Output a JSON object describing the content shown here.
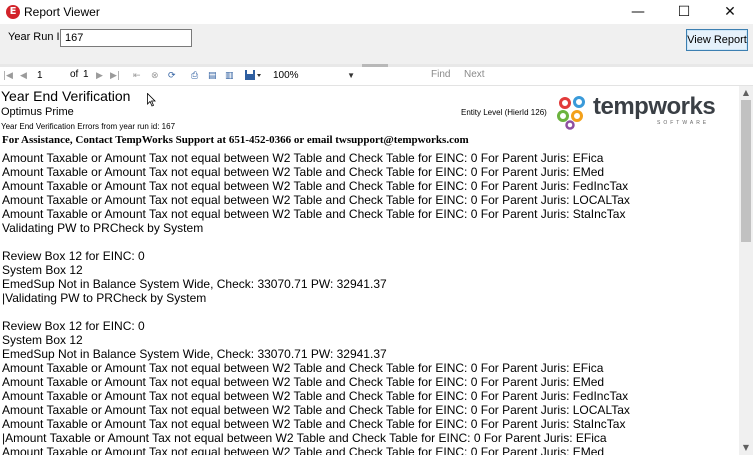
{
  "window": {
    "app_icon": "E",
    "title": "Report Viewer",
    "minimize_glyph": "—",
    "maximize_glyph": "☐",
    "close_glyph": "✕"
  },
  "params": {
    "year_run_label": "Year Run ID",
    "year_run_value": "167",
    "view_report_label": "View Report"
  },
  "toolbar": {
    "first_glyph": "|◀",
    "prev_glyph": "◀",
    "page": "1",
    "of_label": "of",
    "total_pages": "1",
    "next_glyph": "▶",
    "last_glyph": "▶|",
    "back_glyph": "⇤",
    "stop_glyph": "⊗",
    "refresh_glyph": "⟳",
    "print_glyph": "⎙",
    "layout_glyph": "▤",
    "setup_glyph": "▥",
    "export_glyph": "▼",
    "zoom": "100%",
    "find_label": "Find",
    "next_label": "Next"
  },
  "report": {
    "title": "Year End Verification",
    "company": "Optimus Prime",
    "errors_heading": "Year End Verification Errors from year run id: 167",
    "entity_level": "Entity Level (HierId 126)",
    "logo_text": "tempworks",
    "logo_sub": "SOFTWARE",
    "assistance": "For Assistance, Contact TempWorks Support at 651-452-0366 or email twsupport@tempworks.com",
    "lines": [
      "Amount Taxable or Amount Tax not equal between W2 Table and Check Table for EINC: 0 For Parent Juris: EFica",
      "Amount Taxable or Amount Tax not equal between W2 Table and Check Table for EINC: 0 For Parent Juris: EMed",
      "Amount Taxable or Amount Tax not equal between W2 Table and Check Table for EINC: 0 For Parent Juris: FedIncTax",
      "Amount Taxable or Amount Tax not equal between W2 Table and Check Table for EINC: 0 For Parent Juris: LOCALTax",
      "Amount Taxable or Amount Tax not equal between W2 Table and Check Table for EINC: 0 For Parent Juris: StaIncTax",
      "Validating PW to PRCheck by System",
      "",
      "Review Box 12 for EINC: 0",
      "System Box 12",
      "EmedSup Not in Balance System Wide, Check: 33070.71 PW: 32941.37",
      "|Validating PW to PRCheck by System",
      "",
      "Review Box 12 for EINC: 0",
      "System Box 12",
      "EmedSup Not in Balance System Wide, Check: 33070.71 PW: 32941.37",
      "Amount Taxable or Amount Tax not equal between W2 Table and Check Table for EINC: 0 For Parent Juris: EFica",
      "Amount Taxable or Amount Tax not equal between W2 Table and Check Table for EINC: 0 For Parent Juris: EMed",
      "Amount Taxable or Amount Tax not equal between W2 Table and Check Table for EINC: 0 For Parent Juris: FedIncTax",
      "Amount Taxable or Amount Tax not equal between W2 Table and Check Table for EINC: 0 For Parent Juris: LOCALTax",
      "Amount Taxable or Amount Tax not equal between W2 Table and Check Table for EINC: 0 For Parent Juris: StaIncTax",
      "|Amount Taxable or Amount Tax not equal between W2 Table and Check Table for EINC: 0 For Parent Juris: EFica",
      "Amount Taxable or Amount Tax not equal between W2 Table and Check Table for EINC: 0 For Parent Juris: EMed"
    ]
  },
  "scrollbar": {
    "up_glyph": "▲",
    "down_glyph": "▼"
  },
  "colors": {
    "accent": "#3c7fb1",
    "brand_red": "#d2232a"
  }
}
